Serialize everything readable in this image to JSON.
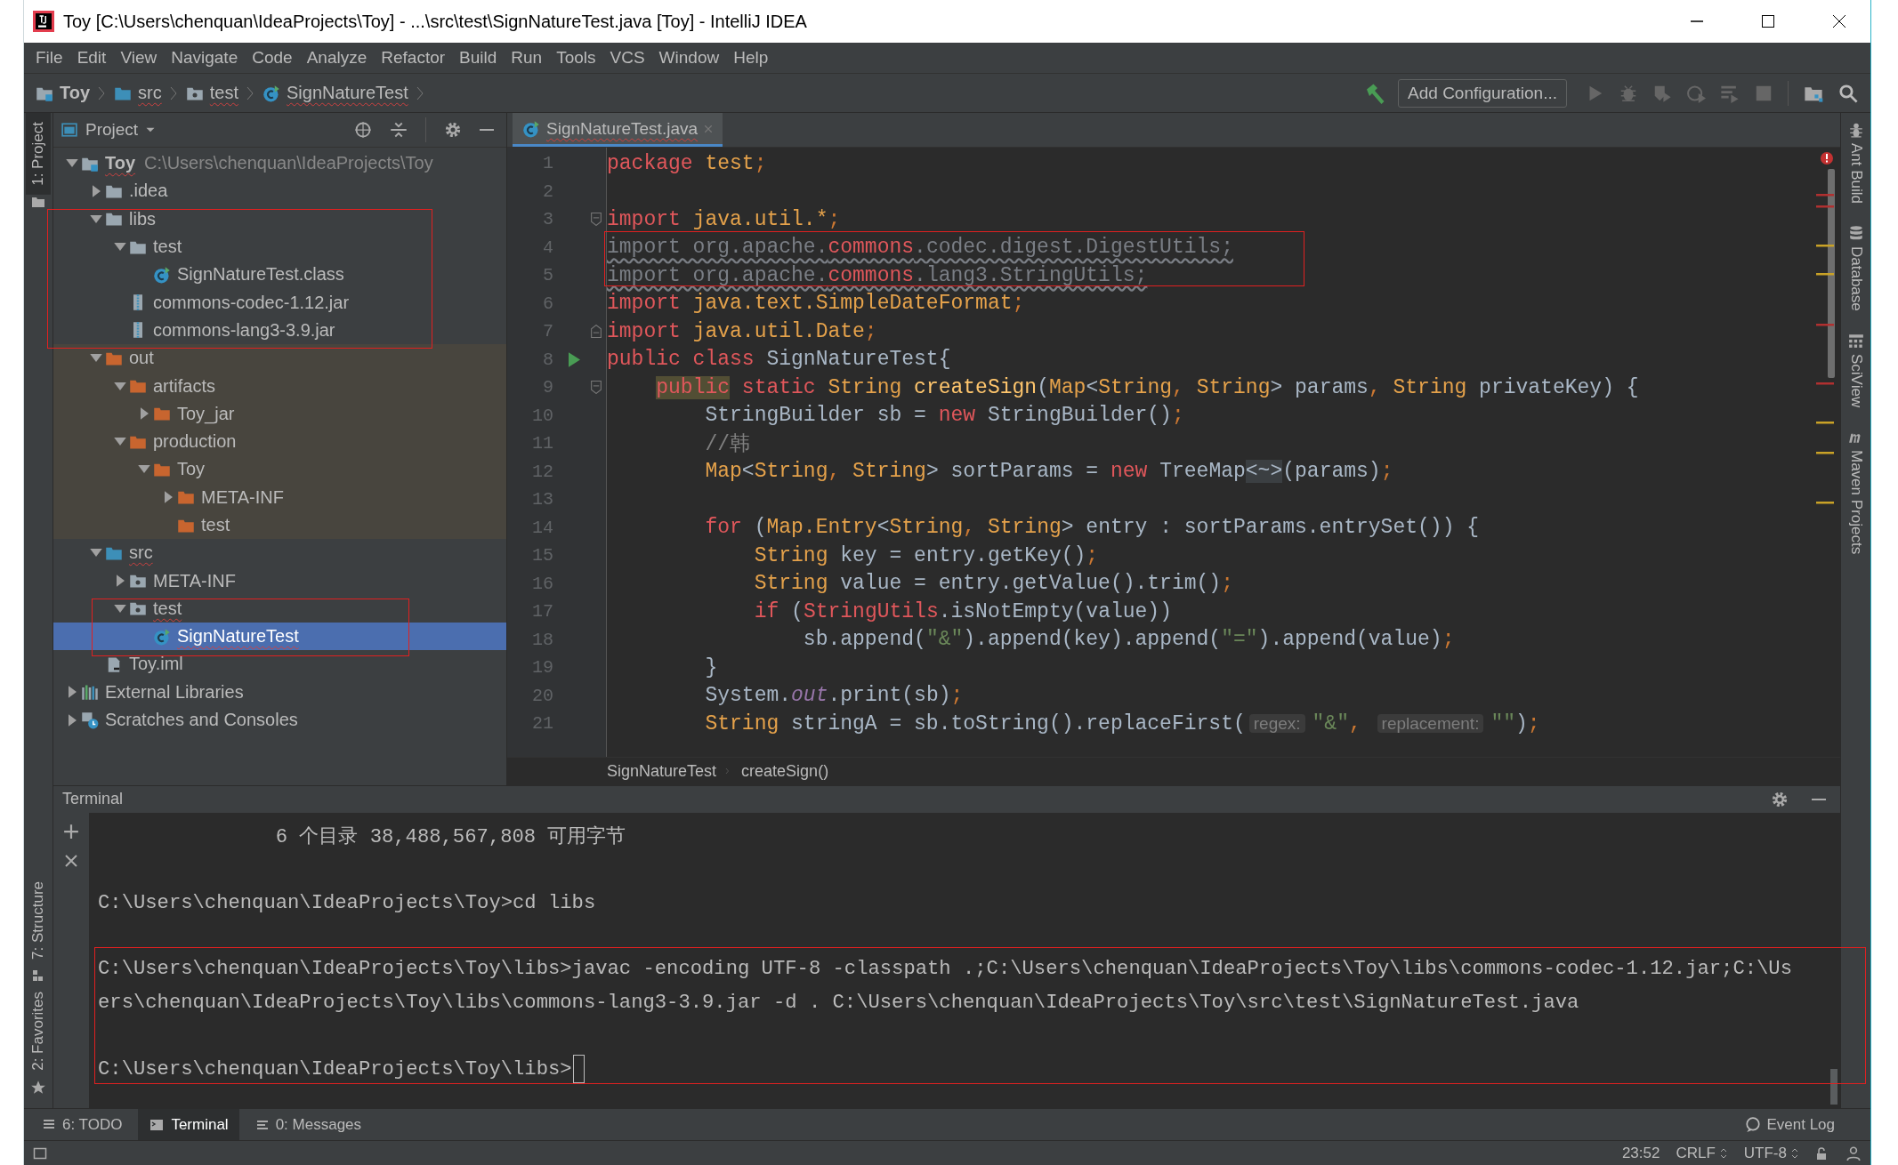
{
  "window": {
    "title": "Toy [C:\\Users\\chenquan\\IdeaProjects\\Toy] - ...\\src\\test\\SignNatureTest.java [Toy] - IntelliJ IDEA"
  },
  "menu": [
    "File",
    "Edit",
    "View",
    "Navigate",
    "Code",
    "Analyze",
    "Refactor",
    "Build",
    "Run",
    "Tools",
    "VCS",
    "Window",
    "Help"
  ],
  "navbar": {
    "crumbs": [
      {
        "label": "Toy",
        "kind": "project",
        "typo": false
      },
      {
        "label": "src",
        "kind": "source",
        "typo": true
      },
      {
        "label": "test",
        "kind": "package",
        "typo": true
      },
      {
        "label": "SignNatureTest",
        "kind": "class",
        "typo": true
      }
    ],
    "run_config": "Add Configuration..."
  },
  "left_tools": [
    {
      "label": "1: Project",
      "kind": "project",
      "selected": true
    },
    {
      "label": "7: Structure",
      "kind": "structure",
      "selected": false
    },
    {
      "label": "2: Favorites",
      "kind": "favorites",
      "selected": false
    }
  ],
  "project": {
    "title": "Project",
    "tree": [
      {
        "label": "Toy",
        "kind": "project",
        "bold": true,
        "typo": true,
        "hint": "C:\\Users\\chenquan\\IdeaProjects\\Toy",
        "expanded": true,
        "selected": false,
        "children": [
          {
            "label": ".idea",
            "kind": "folder",
            "expanded": false,
            "selected": false
          },
          {
            "label": "libs",
            "kind": "folder",
            "expanded": true,
            "selected": false,
            "children": [
              {
                "label": "test",
                "kind": "folder",
                "expanded": true,
                "selected": false,
                "children": [
                  {
                    "label": "SignNatureTest.class",
                    "kind": "class",
                    "selected": false
                  }
                ]
              },
              {
                "label": "commons-codec-1.12.jar",
                "kind": "jar",
                "selected": false
              },
              {
                "label": "commons-lang3-3.9.jar",
                "kind": "jar",
                "selected": false
              }
            ]
          },
          {
            "label": "out",
            "kind": "excluded",
            "expanded": true,
            "selected": false,
            "children": [
              {
                "label": "artifacts",
                "kind": "excluded",
                "expanded": true,
                "selected": false,
                "children": [
                  {
                    "label": "Toy_jar",
                    "kind": "excluded",
                    "expanded": false,
                    "selected": false
                  }
                ]
              },
              {
                "label": "production",
                "kind": "excluded",
                "expanded": true,
                "selected": false,
                "children": [
                  {
                    "label": "Toy",
                    "kind": "excluded",
                    "expanded": true,
                    "selected": false,
                    "children": [
                      {
                        "label": "META-INF",
                        "kind": "excluded",
                        "expanded": false,
                        "selected": false
                      },
                      {
                        "label": "test",
                        "kind": "excluded",
                        "selected": false
                      }
                    ]
                  }
                ]
              }
            ]
          },
          {
            "label": "src",
            "kind": "source",
            "typo": true,
            "expanded": true,
            "selected": false,
            "children": [
              {
                "label": "META-INF",
                "kind": "package",
                "expanded": false,
                "selected": false
              },
              {
                "label": "test",
                "kind": "package",
                "typo": true,
                "expanded": true,
                "selected": false,
                "children": [
                  {
                    "label": "SignNatureTest",
                    "kind": "class",
                    "typo": true,
                    "selected": true
                  }
                ]
              }
            ]
          },
          {
            "label": "Toy.iml",
            "kind": "iml",
            "selected": false
          }
        ]
      },
      {
        "label": "External Libraries",
        "kind": "libraries",
        "expanded": false,
        "selected": false
      },
      {
        "label": "Scratches and Consoles",
        "kind": "scratches",
        "expanded": false,
        "selected": false
      }
    ]
  },
  "editor": {
    "tabs": [
      {
        "label": "SignNatureTest.java",
        "selected": true,
        "typo": true
      }
    ],
    "lines": [
      {
        "n": "1",
        "tokens": [
          {
            "text": "package ",
            "kind": "kw"
          },
          {
            "text": "test",
            "kind": "pkg"
          },
          {
            "text": ";",
            "kind": "semi"
          }
        ]
      },
      {
        "n": "2"
      },
      {
        "n": "3",
        "fold_open": true,
        "tokens": [
          {
            "text": "import ",
            "kind": "kw"
          },
          {
            "text": "java.util.*",
            "kind": "pkg"
          },
          {
            "text": ";",
            "kind": "semi"
          }
        ]
      },
      {
        "n": "4",
        "tokens": [
          {
            "text": "import org.apache.",
            "kind": "unused"
          },
          {
            "text": "commons",
            "kind": "errunused"
          },
          {
            "text": ".codec.digest.DigestUtils;",
            "kind": "unused"
          }
        ]
      },
      {
        "n": "5",
        "tokens": [
          {
            "text": "import org.apache.",
            "kind": "unused"
          },
          {
            "text": "commons",
            "kind": "errunused"
          },
          {
            "text": ".lang3.StringUtils;",
            "kind": "unused"
          }
        ]
      },
      {
        "n": "6",
        "tokens": [
          {
            "text": "import ",
            "kind": "kw"
          },
          {
            "text": "java.text.SimpleDateFormat",
            "kind": "pkg"
          },
          {
            "text": ";",
            "kind": "semi"
          }
        ]
      },
      {
        "n": "7",
        "fold_close": true,
        "tokens": [
          {
            "text": "import ",
            "kind": "kw"
          },
          {
            "text": "java.util.Date",
            "kind": "pkg"
          },
          {
            "text": ";",
            "kind": "semi"
          }
        ]
      },
      {
        "n": "8",
        "run": true,
        "tokens": [
          {
            "text": "public class ",
            "kind": "kw"
          },
          {
            "text": "SignNatureTest{",
            "kind": "plain"
          }
        ]
      },
      {
        "n": "9",
        "fold_open": true,
        "tokens": [
          {
            "text": "    public",
            "kind": "kwhl"
          },
          {
            "text": " static ",
            "kind": "kw"
          },
          {
            "text": "String ",
            "kind": "type"
          },
          {
            "text": "createSign",
            "kind": "method"
          },
          {
            "text": "(",
            "kind": "plain"
          },
          {
            "text": "Map",
            "kind": "type"
          },
          {
            "text": "<",
            "kind": "plain"
          },
          {
            "text": "String",
            "kind": "type"
          },
          {
            "text": ", ",
            "kind": "semi"
          },
          {
            "text": "String",
            "kind": "type"
          },
          {
            "text": "> params",
            "kind": "plain"
          },
          {
            "text": ", ",
            "kind": "semi"
          },
          {
            "text": "String ",
            "kind": "type"
          },
          {
            "text": "privateKey) {",
            "kind": "plain"
          }
        ]
      },
      {
        "n": "10",
        "tokens": [
          {
            "text": "        StringBuilder sb = ",
            "kind": "plain"
          },
          {
            "text": "new ",
            "kind": "kw"
          },
          {
            "text": "StringBuilder()",
            "kind": "plain"
          },
          {
            "text": ";",
            "kind": "semi"
          }
        ]
      },
      {
        "n": "11",
        "tokens": [
          {
            "text": "        //韩",
            "kind": "comment"
          }
        ]
      },
      {
        "n": "12",
        "tokens": [
          {
            "text": "        Map",
            "kind": "type"
          },
          {
            "text": "<",
            "kind": "plain"
          },
          {
            "text": "String",
            "kind": "type"
          },
          {
            "text": ", ",
            "kind": "semi"
          },
          {
            "text": "String",
            "kind": "type"
          },
          {
            "text": "> sortParams = ",
            "kind": "plain"
          },
          {
            "text": "new ",
            "kind": "kw"
          },
          {
            "text": "TreeMap",
            "kind": "plain"
          },
          {
            "text": "<~>",
            "kind": "fold"
          },
          {
            "text": "(params)",
            "kind": "plain"
          },
          {
            "text": ";",
            "kind": "semi"
          }
        ]
      },
      {
        "n": "13"
      },
      {
        "n": "14",
        "tokens": [
          {
            "text": "        for ",
            "kind": "kw"
          },
          {
            "text": "(",
            "kind": "plain"
          },
          {
            "text": "Map.Entry",
            "kind": "type"
          },
          {
            "text": "<",
            "kind": "plain"
          },
          {
            "text": "String",
            "kind": "type"
          },
          {
            "text": ", ",
            "kind": "semi"
          },
          {
            "text": "String",
            "kind": "type"
          },
          {
            "text": "> entry : sortParams.entrySet()) {",
            "kind": "plain"
          }
        ]
      },
      {
        "n": "15",
        "tokens": [
          {
            "text": "            String ",
            "kind": "type"
          },
          {
            "text": "key = entry.getKey()",
            "kind": "plain"
          },
          {
            "text": ";",
            "kind": "semi"
          }
        ]
      },
      {
        "n": "16",
        "tokens": [
          {
            "text": "            String ",
            "kind": "type"
          },
          {
            "text": "value = entry.getValue().trim()",
            "kind": "plain"
          },
          {
            "text": ";",
            "kind": "semi"
          }
        ]
      },
      {
        "n": "17",
        "tokens": [
          {
            "text": "            if ",
            "kind": "kw"
          },
          {
            "text": "(",
            "kind": "plain"
          },
          {
            "text": "StringUtils",
            "kind": "err"
          },
          {
            "text": ".isNotEmpty(value))",
            "kind": "plain"
          }
        ]
      },
      {
        "n": "18",
        "tokens": [
          {
            "text": "                sb.append(",
            "kind": "plain"
          },
          {
            "text": "\"&\"",
            "kind": "str"
          },
          {
            "text": ").append(key).append(",
            "kind": "plain"
          },
          {
            "text": "\"=\"",
            "kind": "str"
          },
          {
            "text": ").append(value)",
            "kind": "plain"
          },
          {
            "text": ";",
            "kind": "semi"
          }
        ]
      },
      {
        "n": "19",
        "tokens": [
          {
            "text": "        }",
            "kind": "plain"
          }
        ]
      },
      {
        "n": "20",
        "tokens": [
          {
            "text": "        System.",
            "kind": "plain"
          },
          {
            "text": "out",
            "kind": "field"
          },
          {
            "text": ".print(sb)",
            "kind": "plain"
          },
          {
            "text": ";",
            "kind": "semi"
          }
        ]
      },
      {
        "n": "21",
        "tokens": [
          {
            "text": "        String ",
            "kind": "type"
          },
          {
            "text": "stringA = sb.toString().replaceFirst(",
            "kind": "plain"
          },
          {
            "text": "regex:",
            "kind": "hint"
          },
          {
            "text": "\"&\"",
            "kind": "str"
          },
          {
            "text": ", ",
            "kind": "semi"
          },
          {
            "text": "replacement:",
            "kind": "hint"
          },
          {
            "text": "\"\"",
            "kind": "str"
          },
          {
            "text": ")",
            "kind": "plain"
          },
          {
            "text": ";",
            "kind": "semi"
          }
        ]
      }
    ],
    "breadcrumb": [
      "SignNatureTest",
      "createSign()"
    ]
  },
  "right_tools": [
    {
      "label": "Ant Build",
      "kind": "ant"
    },
    {
      "label": "Database",
      "kind": "database"
    },
    {
      "label": "SciView",
      "kind": "sciview"
    },
    {
      "label": "Maven Projects",
      "kind": "maven"
    }
  ],
  "terminal": {
    "title": "Terminal",
    "blocks": [
      {
        "lines": [
          "               6 个目录 38,488,567,808 可用字节"
        ]
      },
      {
        "lines": [
          "C:\\Users\\chenquan\\IdeaProjects\\Toy>cd libs"
        ]
      },
      {
        "lines": [
          "C:\\Users\\chenquan\\IdeaProjects\\Toy\\libs>javac -encoding UTF-8 -classpath .;C:\\Users\\chenquan\\IdeaProjects\\Toy\\libs\\commons-codec-1.12.jar;C:\\Us",
          "ers\\chenquan\\IdeaProjects\\Toy\\libs\\commons-lang3-3.9.jar -d . C:\\Users\\chenquan\\IdeaProjects\\Toy\\src\\test\\SignNatureTest.java"
        ]
      },
      {
        "lines": [
          "C:\\Users\\chenquan\\IdeaProjects\\Toy\\libs>"
        ],
        "cursor": true
      }
    ]
  },
  "bottom_tools": [
    {
      "label": "6: TODO",
      "kind": "todo",
      "selected": false
    },
    {
      "label": "Terminal",
      "kind": "terminal",
      "selected": true
    },
    {
      "label": "0: Messages",
      "kind": "messages",
      "selected": false
    }
  ],
  "event_log": "Event Log",
  "status": {
    "position": "23:52",
    "line_separator": "CRLF",
    "encoding": "UTF-8"
  }
}
